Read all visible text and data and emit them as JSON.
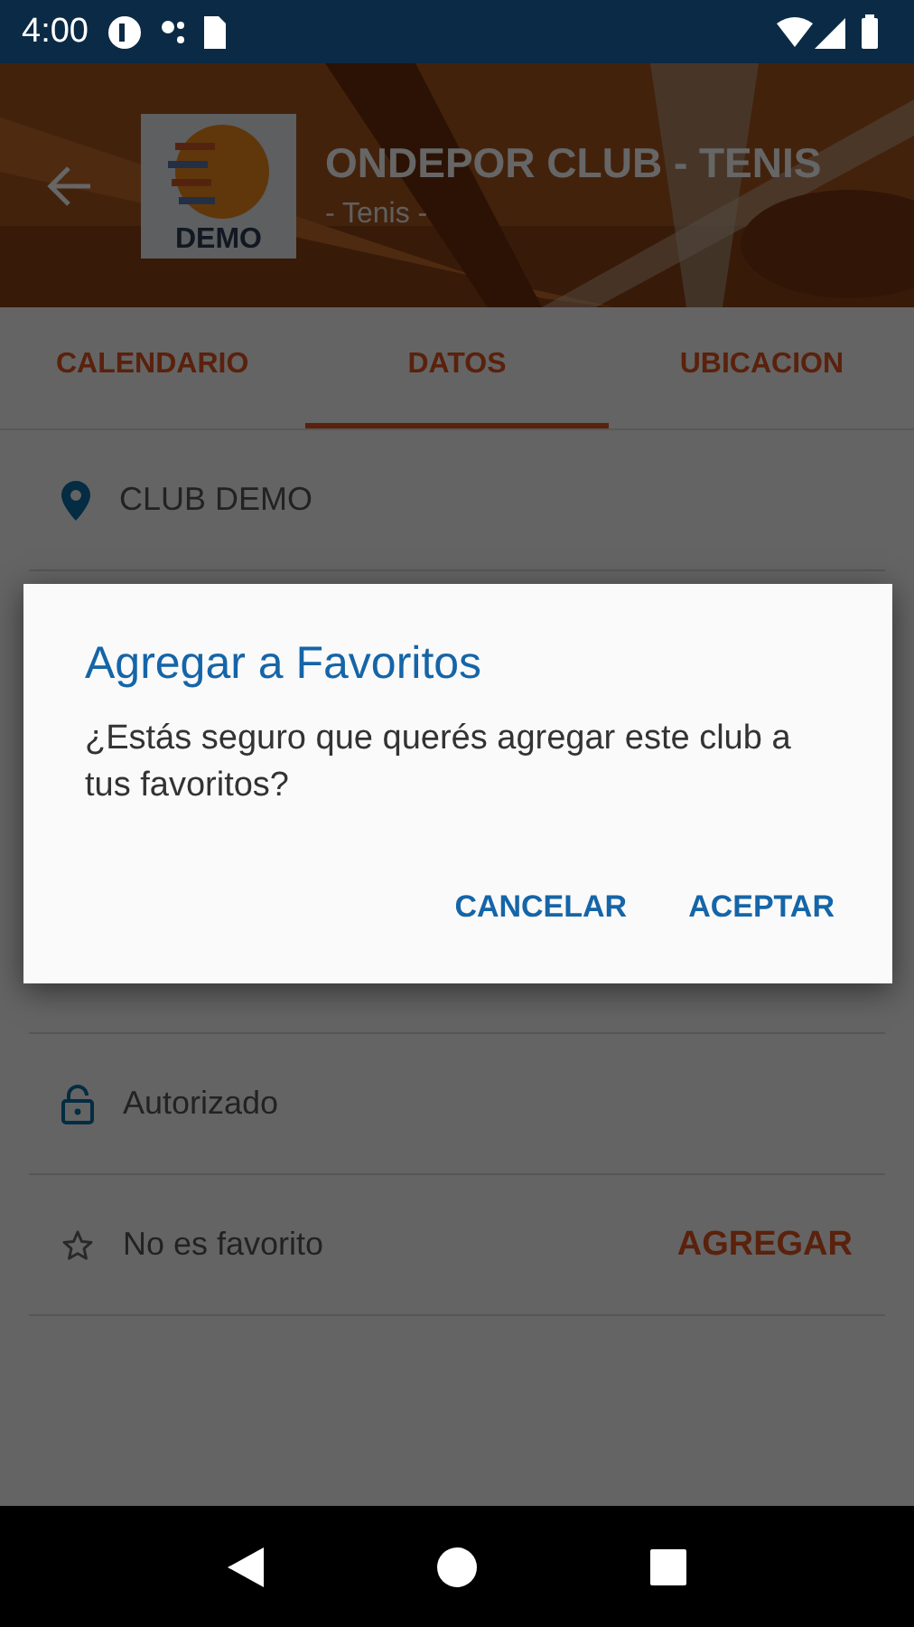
{
  "status_bar": {
    "time": "4:00"
  },
  "header": {
    "title": "ONDEPOR CLUB - TENIS",
    "subtitle": "- Tenis -",
    "logo_text": "DEMO"
  },
  "tabs": [
    {
      "label": "CALENDARIO",
      "selected": false
    },
    {
      "label": "DATOS",
      "selected": true
    },
    {
      "label": "UBICACION",
      "selected": false
    }
  ],
  "rows_top": [
    {
      "kind": "location",
      "text": "CLUB DEMO"
    }
  ],
  "rows_bottom": [
    {
      "kind": "lock",
      "text": "Autorizado"
    },
    {
      "kind": "star",
      "text": "No es favorito",
      "action": "AGREGAR"
    }
  ],
  "dialog": {
    "title": "Agregar a Favoritos",
    "message": "¿Estás seguro que querés agregar este club a tus favoritos?",
    "buttons": [
      "CANCELAR",
      "ACEPTAR"
    ]
  }
}
